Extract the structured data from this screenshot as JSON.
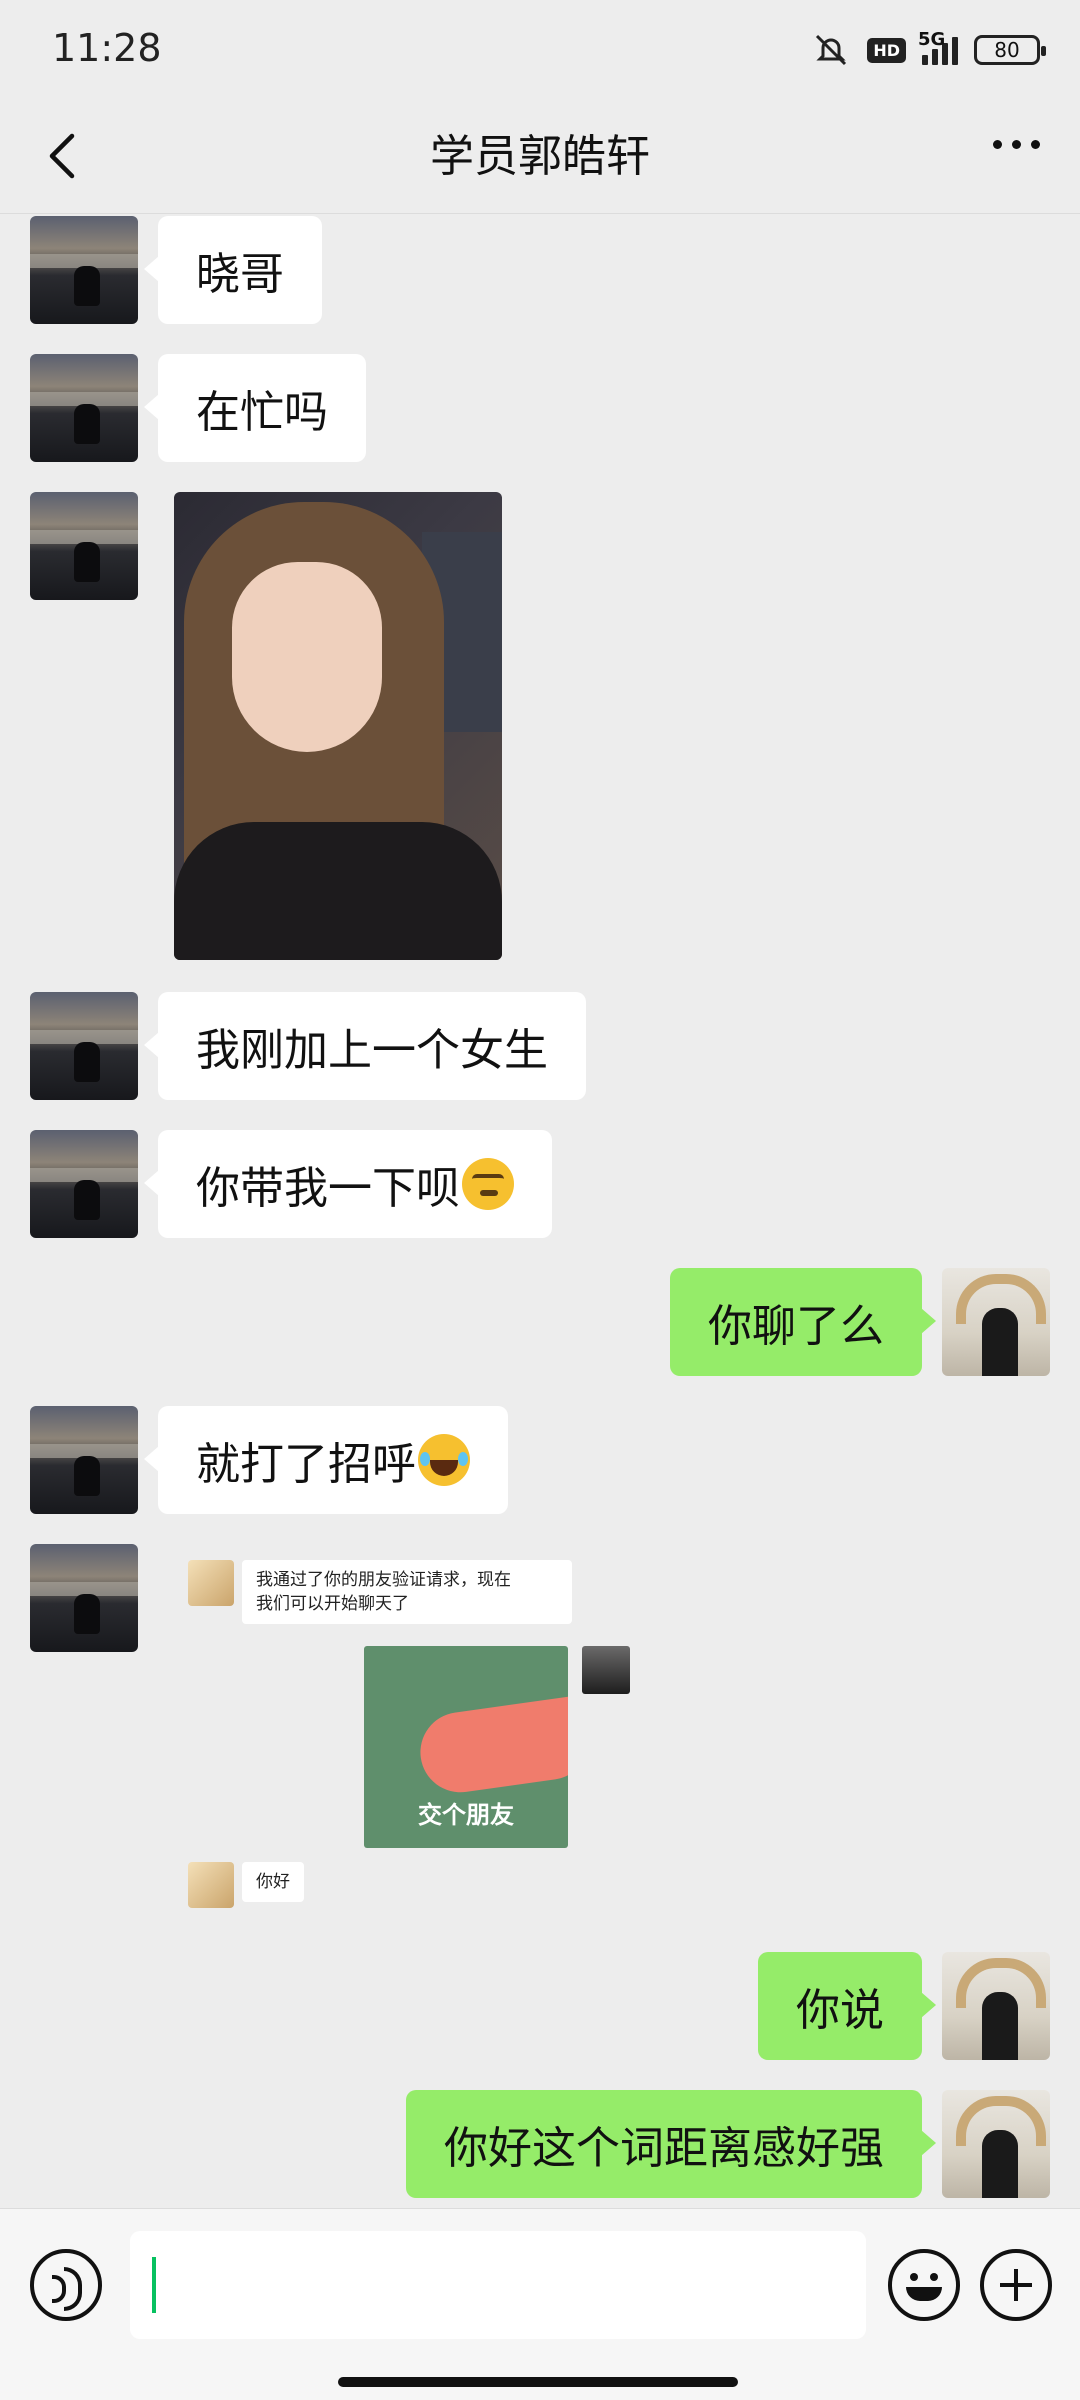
{
  "status_bar": {
    "time": "11:28",
    "hd": "HD",
    "network": "5G",
    "battery": "80"
  },
  "header": {
    "title": "学员郭皓轩"
  },
  "messages": [
    {
      "from": "contact",
      "text": "晓哥"
    },
    {
      "from": "contact",
      "text": "在忙吗"
    },
    {
      "from": "contact",
      "type": "image"
    },
    {
      "from": "contact",
      "text": "我刚加上一个女生"
    },
    {
      "from": "contact",
      "text": "你带我一下呗"
    },
    {
      "from": "me",
      "text": "你聊了么"
    },
    {
      "from": "contact",
      "text": "就打了招呼"
    },
    {
      "from": "contact",
      "type": "screenshot"
    },
    {
      "from": "me",
      "text": "你说"
    },
    {
      "from": "me",
      "text": "你好这个词距离感好强"
    }
  ],
  "screenshot": {
    "system_line1": "我通过了你的朋友验证请求，现在",
    "system_line2": "我们可以开始聊天了",
    "sticker_caption": "交个朋友",
    "reply": "你好"
  },
  "input": {
    "value": "",
    "placeholder": ""
  },
  "icons": {
    "back": "chevron-left-icon",
    "more": "more-dots-icon",
    "mute": "bell-off-icon",
    "voice": "voice-icon",
    "emoji": "emoji-icon",
    "plus": "plus-icon"
  },
  "colors": {
    "accent_green": "#95ec69",
    "background": "#ededed",
    "caret": "#07c160"
  }
}
